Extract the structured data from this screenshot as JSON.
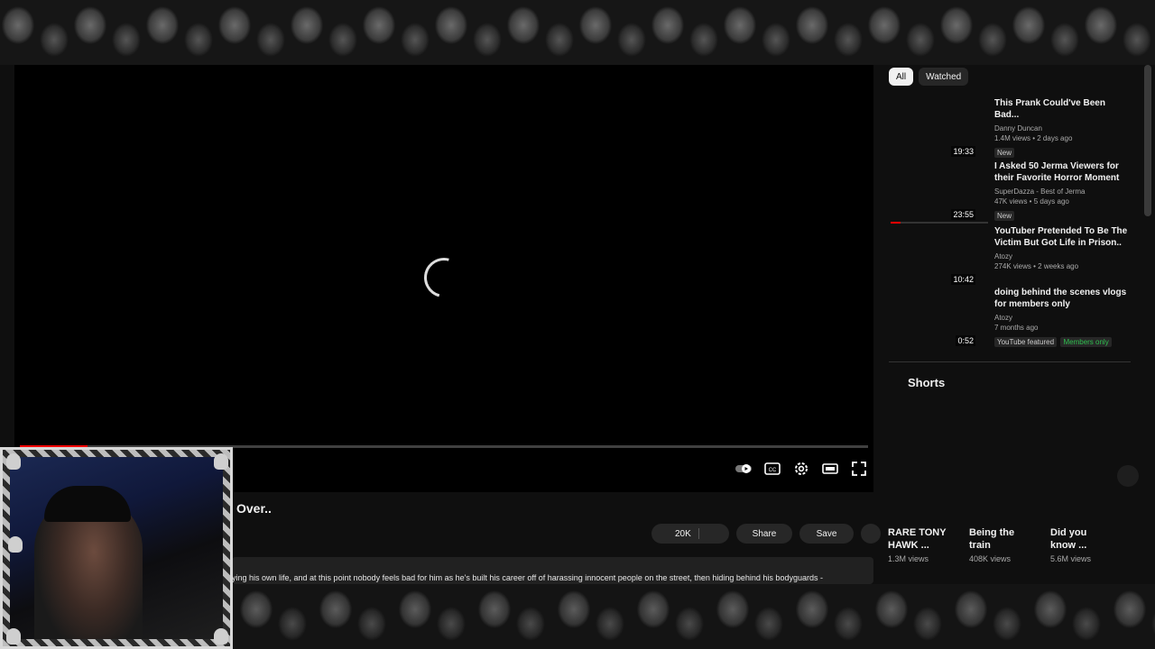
{
  "player": {
    "progress_fraction": 0.08
  },
  "video": {
    "title_fragment": "Over..",
    "likes": "20K",
    "share_label": "Share",
    "save_label": "Save",
    "description_snippet": "ying his own life, and at this point nobody feels bad for him as he's built his career off of harassing innocent people on the street, then hiding behind his bodyguards -"
  },
  "filters": {
    "all": "All",
    "watched": "Watched"
  },
  "recommendations": [
    {
      "title": "This Prank Could've Been Bad...",
      "channel": "Danny Duncan",
      "meta": "1.4M views • 2 days ago",
      "badges": [
        "New"
      ],
      "duration": "19:33",
      "watched_fraction": 0
    },
    {
      "title": "I Asked 50 Jerma Viewers for their Favorite Horror Moment",
      "channel": "SuperDazza - Best of Jerma",
      "meta": "47K views • 5 days ago",
      "badges": [
        "New"
      ],
      "duration": "23:55",
      "watched_fraction": 0.1
    },
    {
      "title": "YouTuber Pretended To Be The Victim But Got Life in Prison..",
      "channel": "Atozy",
      "meta": "274K views • 2 weeks ago",
      "badges": [],
      "duration": "10:42",
      "watched_fraction": 0
    },
    {
      "title": "doing behind the scenes vlogs for members only",
      "channel": "Atozy",
      "meta": "7 months ago",
      "badges": [
        "YouTube featured",
        "Members only"
      ],
      "duration": "0:52",
      "watched_fraction": 0
    }
  ],
  "shorts": {
    "heading": "Shorts",
    "items": [
      {
        "title": "RARE TONY HAWK ...",
        "views": "1.3M views"
      },
      {
        "title": "Being the train",
        "views": "408K views"
      },
      {
        "title": "Did you know ...",
        "views": "5.6M views"
      }
    ]
  },
  "colors": {
    "accent": "#ff0000",
    "members_badge": "#2fbf4f",
    "page_bg": "#0f0f0f"
  },
  "icons": [
    "autoplay-toggle-icon",
    "captions-icon",
    "settings-gear-icon",
    "theater-mode-icon",
    "fullscreen-icon",
    "loading-spinner-icon"
  ]
}
